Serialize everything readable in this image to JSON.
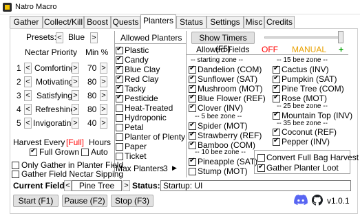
{
  "window": {
    "title": "Natro Macro"
  },
  "tabs": [
    "Gather",
    "Collect/Kill",
    "Boost",
    "Quests",
    "Planters",
    "Status",
    "Settings",
    "Misc",
    "Credits"
  ],
  "colors": {
    "off": "#ff0000",
    "manual": "#e8a000",
    "plus": "#00a000",
    "harvest_full": "#ff0000"
  },
  "presets": {
    "label": "Presets:",
    "value": "Blue",
    "prev": "<",
    "next": ">"
  },
  "nectar": {
    "header_label": "Nectar Priority",
    "min_label": "Min %",
    "rows": [
      {
        "num": "1",
        "name": "Comforting",
        "min": "70"
      },
      {
        "num": "2",
        "name": "Motivating",
        "min": "80"
      },
      {
        "num": "3",
        "name": "Satisfying",
        "min": "80"
      },
      {
        "num": "4",
        "name": "Refreshing",
        "min": "80"
      },
      {
        "num": "5",
        "name": "Invigorating",
        "min": "40"
      }
    ]
  },
  "harvest": {
    "label": "Harvest Every",
    "value": "[Full]",
    "unit": "Hours",
    "full_grown": "Full Grown",
    "auto": "Auto"
  },
  "options": {
    "only_gather": "Only Gather in Planter Field",
    "gather_nectar_sipping": "Gather Field Nectar Sipping"
  },
  "allowed_planters": {
    "header": "Allowed Planters",
    "items": [
      {
        "name": "Plastic",
        "checked": true
      },
      {
        "name": "Candy",
        "checked": true
      },
      {
        "name": "Blue Clay",
        "checked": true
      },
      {
        "name": "Red Clay",
        "checked": true
      },
      {
        "name": "Tacky",
        "checked": true
      },
      {
        "name": "Pesticide",
        "checked": true
      },
      {
        "name": "Heat-Treated",
        "checked": false
      },
      {
        "name": "Hydroponic",
        "checked": false
      },
      {
        "name": "Petal",
        "checked": false
      },
      {
        "name": "Planter of Plenty",
        "checked": false
      },
      {
        "name": "Paper",
        "checked": false
      },
      {
        "name": "Ticket",
        "checked": false
      }
    ],
    "max_label": "Max Planters",
    "max_value": "3"
  },
  "show_timers": {
    "label": "Show Timers (F5)"
  },
  "allowed_fields": {
    "header": "Allowed Fields",
    "off": "OFF",
    "manual": "MANUAL",
    "plus": "+",
    "left": [
      {
        "type": "zone",
        "text": "-- starting zone --"
      },
      {
        "type": "field",
        "name": "Dandelion (COM)",
        "checked": true
      },
      {
        "type": "field",
        "name": "Sunflower (SAT)",
        "checked": true
      },
      {
        "type": "field",
        "name": "Mushroom (MOT)",
        "checked": true
      },
      {
        "type": "field",
        "name": "Blue Flower (REF)",
        "checked": true
      },
      {
        "type": "field",
        "name": "Clover (INV)",
        "checked": true
      },
      {
        "type": "zone",
        "text": "-- 5 bee zone --"
      },
      {
        "type": "field",
        "name": "Spider (MOT)",
        "checked": true
      },
      {
        "type": "field",
        "name": "Strawberry (REF)",
        "checked": true
      },
      {
        "type": "field",
        "name": "Bamboo (COM)",
        "checked": true
      },
      {
        "type": "zone",
        "text": "-- 10 bee zone --"
      },
      {
        "type": "field",
        "name": "Pineapple (SAT)",
        "checked": true
      },
      {
        "type": "field",
        "name": "Stump (MOT)",
        "checked": false
      }
    ],
    "right": [
      {
        "type": "zone",
        "text": "-- 15 bee zone --"
      },
      {
        "type": "field",
        "name": "Cactus (INV)",
        "checked": true
      },
      {
        "type": "field",
        "name": "Pumpkin (SAT)",
        "checked": true
      },
      {
        "type": "field",
        "name": "Pine Tree (COM)",
        "checked": true
      },
      {
        "type": "field",
        "name": "Rose (MOT)",
        "checked": true
      },
      {
        "type": "zone",
        "text": "-- 25 bee zone --"
      },
      {
        "type": "field",
        "name": "Mountain Top (INV)",
        "checked": true
      },
      {
        "type": "zone",
        "text": "-- 35 bee zone --"
      },
      {
        "type": "field",
        "name": "Coconut (REF)",
        "checked": true
      },
      {
        "type": "field",
        "name": "Pepper (INV)",
        "checked": true
      }
    ],
    "convert_full_bag": {
      "name": "Convert Full Bag Harvest",
      "checked": false
    },
    "gather_planter_loot": {
      "name": "Gather Planter Loot",
      "checked": true
    }
  },
  "current_field": {
    "label": "Current Field:",
    "value": "Pine Tree",
    "prev": "<",
    "next": ">"
  },
  "status": {
    "label": "Status:",
    "value": "Startup: UI"
  },
  "footer": {
    "start": "Start (F1)",
    "pause": "Pause (F2)",
    "stop": "Stop (F3)",
    "version": "v1.0.1"
  }
}
